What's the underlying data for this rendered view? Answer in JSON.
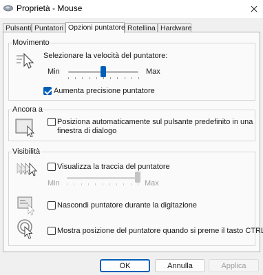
{
  "window": {
    "title": "Proprietà - Mouse",
    "close_glyph": "✕"
  },
  "tabs": [
    {
      "label": "Pulsanti",
      "active": false
    },
    {
      "label": "Puntatori",
      "active": false
    },
    {
      "label": "Opzioni puntatore",
      "active": true
    },
    {
      "label": "Rotellina",
      "active": false
    },
    {
      "label": "Hardware",
      "active": false
    }
  ],
  "movement": {
    "group_label": "Movimento",
    "speed_label": "Selezionare la velocità del puntatore:",
    "min_label": "Min",
    "max_label": "Max",
    "speed_value_fraction": 0.5,
    "precision_label": "Aumenta precisione puntatore",
    "precision_checked": true
  },
  "snap_to": {
    "group_label": "Ancora a",
    "label_line1": "Posiziona automaticamente sul pulsante predefinito in una",
    "label_line2": "finestra di dialogo",
    "checked": false
  },
  "visibility": {
    "group_label": "Visibilità",
    "trails_label": "Visualizza la traccia del puntatore",
    "trails_checked": false,
    "trails_min_label": "Min",
    "trails_max_label": "Max",
    "trails_value_fraction": 1.0,
    "hide_label": "Nascondi puntatore durante la digitazione",
    "hide_checked": false,
    "ctrl_label": "Mostra posizione del puntatore quando si preme il tasto CTRL",
    "ctrl_checked": false
  },
  "buttons": {
    "ok": "OK",
    "cancel": "Annulla",
    "apply": "Applica"
  },
  "colors": {
    "accent": "#005fb8"
  }
}
